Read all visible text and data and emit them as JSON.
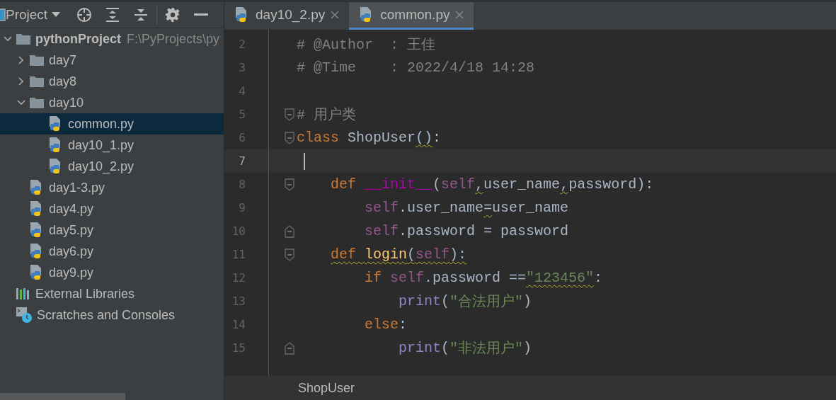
{
  "project_panel": {
    "title": "Project",
    "tree": [
      {
        "label": "pythonProject",
        "path": "F:\\PyProjects\\py",
        "kind": "folder",
        "expanded": true,
        "selected": false,
        "children": [
          {
            "label": "day7",
            "kind": "folder",
            "expanded": false,
            "selected": false
          },
          {
            "label": "day8",
            "kind": "folder",
            "expanded": false,
            "selected": false
          },
          {
            "label": "day10",
            "kind": "folder",
            "expanded": true,
            "selected": false,
            "children": [
              {
                "label": "common.py",
                "kind": "python",
                "selected": true
              },
              {
                "label": "day10_1.py",
                "kind": "python",
                "selected": false
              },
              {
                "label": "day10_2.py",
                "kind": "python",
                "selected": false
              }
            ]
          },
          {
            "label": "day1-3.py",
            "kind": "python",
            "selected": false
          },
          {
            "label": "day4.py",
            "kind": "python",
            "selected": false
          },
          {
            "label": "day5.py",
            "kind": "python",
            "selected": false
          },
          {
            "label": "day6.py",
            "kind": "python",
            "selected": false
          },
          {
            "label": "day9.py",
            "kind": "python",
            "selected": false
          }
        ]
      },
      {
        "label": "External Libraries",
        "kind": "libraries",
        "selected": false
      },
      {
        "label": "Scratches and Consoles",
        "kind": "scratches",
        "selected": false
      }
    ]
  },
  "editor": {
    "tabs": [
      {
        "label": "day10_2.py",
        "selected": false
      },
      {
        "label": "common.py",
        "selected": true
      }
    ],
    "lines": [
      {
        "number": "2",
        "current": false,
        "fold_start": false,
        "fold_end": false,
        "tokens": [
          {
            "kind": "comment",
            "text": "# @Author  : 王佳"
          }
        ]
      },
      {
        "number": "3",
        "current": false,
        "fold_start": false,
        "fold_end": false,
        "tokens": [
          {
            "kind": "comment",
            "text": "# @Time    : 2022/4/18 14:28"
          }
        ]
      },
      {
        "number": "4",
        "current": false,
        "fold_start": false,
        "fold_end": false
      },
      {
        "number": "5",
        "current": false,
        "fold_start": true,
        "fold_end": false,
        "tokens": [
          {
            "kind": "comment",
            "text": "# 用户类"
          }
        ]
      },
      {
        "number": "6",
        "current": false,
        "fold_start": true,
        "fold_end": false,
        "tokens": [
          {
            "kind": "keyword",
            "text": "class "
          },
          {
            "kind": "plain",
            "text": "ShopUser"
          },
          {
            "kind": "plain",
            "text": "()",
            "warning": true
          },
          {
            "kind": "plain",
            "text": ":"
          }
        ]
      },
      {
        "number": "7",
        "current": true,
        "fold_start": false,
        "fold_end": false
      },
      {
        "number": "8",
        "current": false,
        "fold_start": true,
        "fold_end": false,
        "tokens": [
          {
            "kind": "keyword",
            "text": "    def "
          },
          {
            "kind": "magic",
            "text": "__init__"
          },
          {
            "kind": "plain",
            "text": "("
          },
          {
            "kind": "self",
            "text": "self"
          },
          {
            "kind": "plain",
            "text": ",",
            "warning": true
          },
          {
            "kind": "plain",
            "text": "user_name"
          },
          {
            "kind": "plain",
            "text": ",",
            "warning": true
          },
          {
            "kind": "plain",
            "text": "password):"
          }
        ]
      },
      {
        "number": "9",
        "current": false,
        "fold_start": false,
        "fold_end": false,
        "tokens": [
          {
            "kind": "self",
            "text": "        self"
          },
          {
            "kind": "plain",
            "text": ".user_name"
          },
          {
            "kind": "plain",
            "text": "=",
            "warning": true
          },
          {
            "kind": "plain",
            "text": "user_name"
          }
        ]
      },
      {
        "number": "10",
        "current": false,
        "fold_start": false,
        "fold_end": true,
        "tokens": [
          {
            "kind": "self",
            "text": "        self"
          },
          {
            "kind": "plain",
            "text": ".password = password"
          }
        ]
      },
      {
        "number": "11",
        "current": false,
        "fold_start": true,
        "fold_end": false,
        "tokens": [
          {
            "kind": "keyword",
            "text": "    def ",
            "warning": true
          },
          {
            "kind": "function",
            "text": "login",
            "warning": true
          },
          {
            "kind": "plain",
            "text": "(",
            "warning": true
          },
          {
            "kind": "self",
            "text": "self",
            "warning": true
          },
          {
            "kind": "plain",
            "text": "):",
            "warning": true
          }
        ]
      },
      {
        "number": "12",
        "current": false,
        "fold_start": false,
        "fold_end": false,
        "tokens": [
          {
            "kind": "keyword",
            "text": "        if "
          },
          {
            "kind": "self",
            "text": "self"
          },
          {
            "kind": "plain",
            "text": ".password =="
          },
          {
            "kind": "string",
            "text": "\"123456\"",
            "warning": true
          },
          {
            "kind": "plain",
            "text": ":"
          }
        ]
      },
      {
        "number": "13",
        "current": false,
        "fold_start": false,
        "fold_end": false,
        "tokens": [
          {
            "kind": "builtin",
            "text": "            print"
          },
          {
            "kind": "plain",
            "text": "("
          },
          {
            "kind": "string",
            "text": "\"合法用户\""
          },
          {
            "kind": "plain",
            "text": ")"
          }
        ]
      },
      {
        "number": "14",
        "current": false,
        "fold_start": false,
        "fold_end": false,
        "tokens": [
          {
            "kind": "keyword",
            "text": "        else"
          },
          {
            "kind": "plain",
            "text": ":"
          }
        ]
      },
      {
        "number": "15",
        "current": false,
        "fold_start": false,
        "fold_end": true,
        "tokens": [
          {
            "kind": "builtin",
            "text": "            print"
          },
          {
            "kind": "plain",
            "text": "("
          },
          {
            "kind": "string",
            "text": "\"非法用户\""
          },
          {
            "kind": "plain",
            "text": ")"
          }
        ]
      }
    ],
    "breadcrumb": "ShopUser"
  }
}
